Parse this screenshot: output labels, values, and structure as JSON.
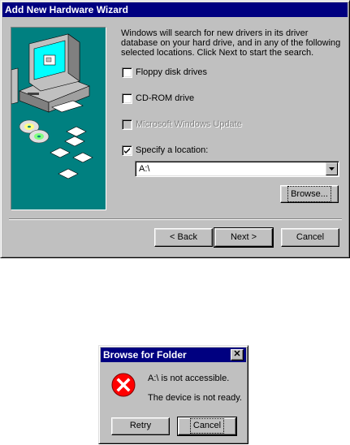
{
  "wizard": {
    "title": "Add New Hardware Wizard",
    "intro": "Windows will search for new drivers in its driver database on your hard drive, and in any of the following selected locations. Click Next to start the search.",
    "options": [
      {
        "label": "Floppy disk drives",
        "checked": false,
        "enabled": true
      },
      {
        "label": "CD-ROM drive",
        "checked": false,
        "enabled": true
      },
      {
        "label": "Microsoft Windows Update",
        "checked": false,
        "enabled": false
      },
      {
        "label": "Specify a location:",
        "checked": true,
        "enabled": true
      }
    ],
    "location_value": "A:\\",
    "browse_label": "Browse...",
    "back_label": "< Back",
    "next_label": "Next >",
    "cancel_label": "Cancel"
  },
  "dialog": {
    "title": "Browse for Folder",
    "close_glyph": "✕",
    "message_line1": "A:\\ is not accessible.",
    "message_line2": "The device is not ready.",
    "retry_label": "Retry",
    "cancel_label": "Cancel"
  },
  "colors": {
    "title_bar": "#000080",
    "face": "#c0c0c0",
    "illustration_bg": "#008080",
    "error_icon": "#ff0000"
  },
  "icons": [
    "computer-icon",
    "cd-icon",
    "floppy-icon",
    "error-icon",
    "dropdown-arrow-icon",
    "checkmark-icon"
  ]
}
